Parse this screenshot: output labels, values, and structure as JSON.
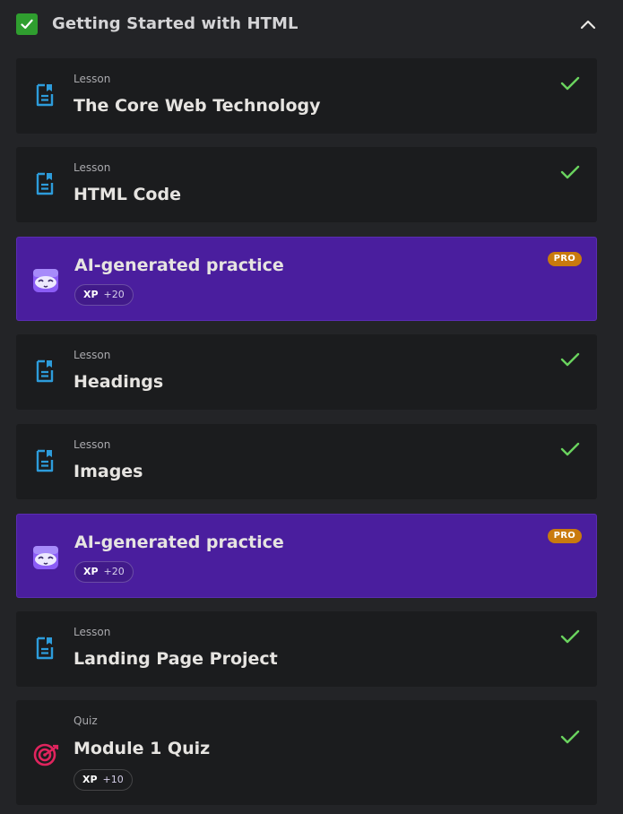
{
  "module": {
    "title": "Getting Started with HTML",
    "completed": true,
    "expanded": true
  },
  "colors": {
    "accent_green": "#2f9e2f",
    "check_green": "#6ad35e",
    "lesson_icon": "#2d9cdb",
    "quiz_icon": "#e0245e",
    "practice_bg": "#4a1e9e",
    "pro_badge": "#c97a0e"
  },
  "items": [
    {
      "kind": "Lesson",
      "title": "The Core Web Technology",
      "icon": "lesson-doc-icon",
      "completed": true
    },
    {
      "kind": "Lesson",
      "title": "HTML Code",
      "icon": "lesson-doc-icon",
      "completed": true
    },
    {
      "kind": "",
      "title": "AI-generated practice",
      "icon": "robot-mascot-icon",
      "badge": "PRO",
      "xp_label": "XP",
      "xp_value": "+20"
    },
    {
      "kind": "Lesson",
      "title": "Headings",
      "icon": "lesson-doc-icon",
      "completed": true
    },
    {
      "kind": "Lesson",
      "title": "Images",
      "icon": "lesson-doc-icon",
      "completed": true
    },
    {
      "kind": "",
      "title": "AI-generated practice",
      "icon": "robot-mascot-icon",
      "badge": "PRO",
      "xp_label": "XP",
      "xp_value": "+20"
    },
    {
      "kind": "Lesson",
      "title": "Landing Page Project",
      "icon": "lesson-doc-icon",
      "completed": true
    },
    {
      "kind": "Quiz",
      "title": "Module 1 Quiz",
      "icon": "target-icon",
      "completed": true,
      "xp_label": "XP",
      "xp_value": "+10"
    }
  ]
}
